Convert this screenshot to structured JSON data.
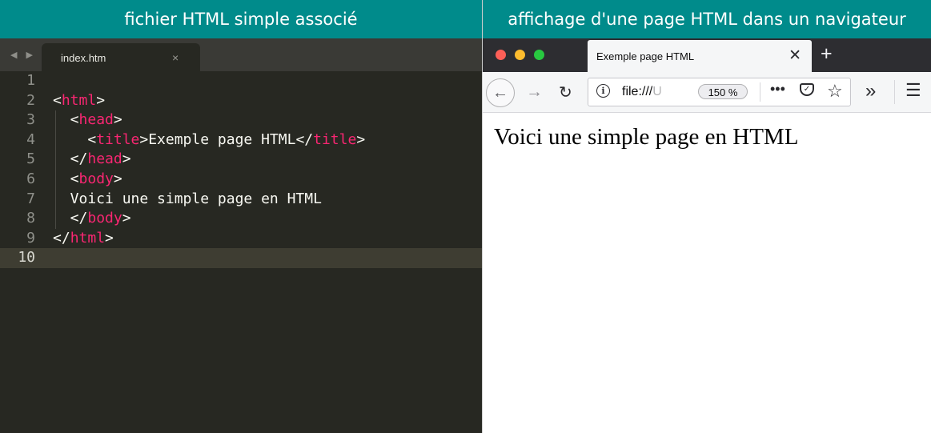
{
  "left_panel": {
    "banner": "fichier HTML simple associé",
    "editor": {
      "nav_arrows": "◀ ▶",
      "tab_label": "index.htm",
      "tab_close": "×",
      "lines": [
        {
          "num": "1",
          "parts": []
        },
        {
          "num": "2",
          "parts": [
            {
              "text": "<"
            },
            {
              "text": "html",
              "tag": true
            },
            {
              "text": ">"
            }
          ]
        },
        {
          "num": "3",
          "parts": [
            {
              "text": "  <"
            },
            {
              "text": "head",
              "tag": true
            },
            {
              "text": ">"
            }
          ]
        },
        {
          "num": "4",
          "parts": [
            {
              "text": "    <"
            },
            {
              "text": "title",
              "tag": true
            },
            {
              "text": ">Exemple page HTML</"
            },
            {
              "text": "title",
              "tag": true
            },
            {
              "text": ">"
            }
          ]
        },
        {
          "num": "5",
          "parts": [
            {
              "text": "  </"
            },
            {
              "text": "head",
              "tag": true
            },
            {
              "text": ">"
            }
          ]
        },
        {
          "num": "6",
          "parts": [
            {
              "text": "  <"
            },
            {
              "text": "body",
              "tag": true
            },
            {
              "text": ">"
            }
          ]
        },
        {
          "num": "7",
          "parts": [
            {
              "text": "  Voici une simple page en HTML"
            }
          ]
        },
        {
          "num": "8",
          "parts": [
            {
              "text": "  </"
            },
            {
              "text": "body",
              "tag": true
            },
            {
              "text": ">"
            }
          ]
        },
        {
          "num": "9",
          "parts": [
            {
              "text": "</"
            },
            {
              "text": "html",
              "tag": true
            },
            {
              "text": ">"
            }
          ]
        },
        {
          "num": "10",
          "parts": [],
          "active": true
        }
      ]
    }
  },
  "right_panel": {
    "banner": "affichage d'une page HTML dans un navigateur",
    "browser": {
      "window_controls": {
        "close": "#fc5f57",
        "minimize": "#fdbc2e",
        "maximize": "#28c840"
      },
      "tab_title": "Exemple page HTML",
      "tab_close": "✕",
      "new_tab": "+",
      "back": "←",
      "forward": "→",
      "reload": "↻",
      "info": "i",
      "url": "file:///",
      "url_fragment": "U",
      "zoom": "150 %",
      "more": "•••",
      "pocket": "✓",
      "bookmark": "☆",
      "overflow": "»",
      "menu": "☰",
      "page_text": "Voici une simple page en HTML"
    }
  },
  "colors": {
    "banner": "#008b8b",
    "editor_bg": "#272822",
    "tag": "#f92672",
    "code_text": "#f8f8f2",
    "gutter": "#8f908a"
  }
}
